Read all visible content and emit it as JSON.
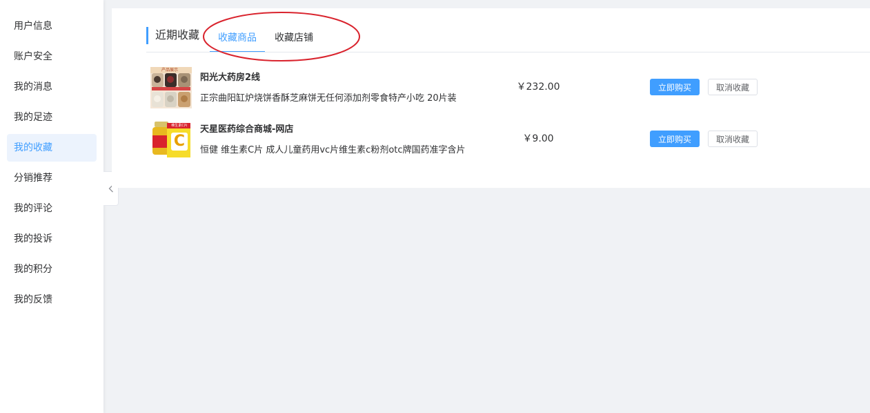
{
  "sidebar": {
    "items": [
      {
        "label": "用户信息",
        "active": false
      },
      {
        "label": "账户安全",
        "active": false
      },
      {
        "label": "我的消息",
        "active": false
      },
      {
        "label": "我的足迹",
        "active": false
      },
      {
        "label": "我的收藏",
        "active": true
      },
      {
        "label": "分销推荐",
        "active": false
      },
      {
        "label": "我的评论",
        "active": false
      },
      {
        "label": "我的投诉",
        "active": false
      },
      {
        "label": "我的积分",
        "active": false
      },
      {
        "label": "我的反馈",
        "active": false
      }
    ]
  },
  "header": {
    "title": "近期收藏",
    "tabs": [
      {
        "label": "收藏商品",
        "active": true
      },
      {
        "label": "收藏店铺",
        "active": false
      }
    ]
  },
  "favorites": [
    {
      "shop": "阳光大药房2线",
      "description": "正宗曲阳缸炉烧饼香酥芝麻饼无任何添加剂零食特产小吃 20片装",
      "price": "￥232.00",
      "thumb_icon": "food-product-thumbnail",
      "thumb_text": "产品展示",
      "buy_label": "立即购买",
      "cancel_label": "取消收藏"
    },
    {
      "shop": "天星医药综合商城-网店",
      "description": "恒健 维生素C片 成人儿童药用vc片维生素c粉剂otc牌国药准字含片",
      "price": "￥9.00",
      "thumb_icon": "vitamin-c-bottle-thumbnail",
      "thumb_text": "维生素C片",
      "thumb_letter": "C",
      "buy_label": "立即购买",
      "cancel_label": "取消收藏"
    }
  ],
  "colors": {
    "accent": "#409eff",
    "active_bg": "#ecf3fd",
    "annotation": "#d9232d",
    "page_bg": "#f0f2f5"
  },
  "icons": {
    "collapse": "chevron-left-icon"
  }
}
